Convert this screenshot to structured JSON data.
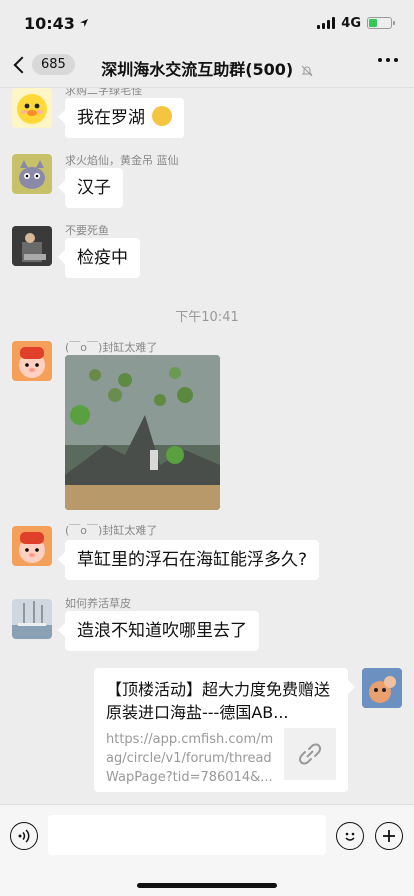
{
  "status": {
    "time": "10:43",
    "network": "4G"
  },
  "nav": {
    "back_count": "685",
    "title": "深圳海水交流互助群(500)"
  },
  "messages": [
    {
      "sender": "求购二字绿毛怪",
      "text": "我在罗湖"
    },
    {
      "sender": "求火焰仙，黄金吊  蓝仙",
      "text": "汉子"
    },
    {
      "sender": "不要死鱼",
      "text": "检疫中"
    },
    {
      "time": "下午10:41"
    },
    {
      "sender": "(￣o￣)封缸太难了",
      "type": "image"
    },
    {
      "sender": "(￣o￣)封缸太难了",
      "text": "草缸里的浮石在海缸能浮多久?"
    },
    {
      "sender": "如何养活草皮",
      "text": "造浪不知道吹哪里去了"
    }
  ],
  "link_card": {
    "title": "【顶楼活动】超大力度免费赠送原装进口海盐---德国AB...",
    "url": "https://app.cmfish.com/mag/circle/v1/forum/threadWapPage?tid=786014&..."
  },
  "input": {
    "placeholder": ""
  },
  "colors": {
    "background": "#ededed",
    "bubble": "#ffffff",
    "accent_battery": "#35c759"
  }
}
